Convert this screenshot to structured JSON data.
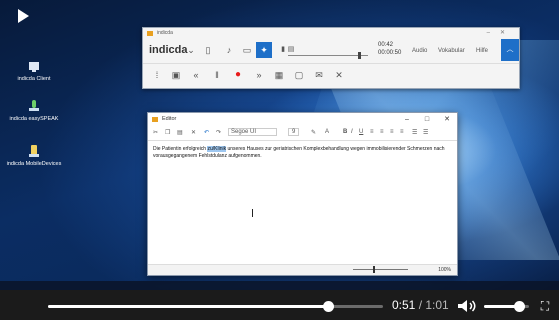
{
  "desktop": {
    "icons": [
      {
        "label": "indicda Client",
        "icon": "client-app-icon"
      },
      {
        "label": "indicda easySPEAK",
        "icon": "microphone-app-icon"
      },
      {
        "label": "indicda MobileDevices",
        "icon": "mobile-app-icon"
      }
    ]
  },
  "toolbar_window": {
    "title": "indicda",
    "logo": "indicda",
    "time_current": "00:42",
    "time_total": "00:00:50",
    "audio_label": "Audio",
    "vocabulary_label": "Vokabular",
    "help_label": "Hilfe",
    "accent_color": "#1e6fc8",
    "record_color": "#e81b1b"
  },
  "editor_window": {
    "title": "Editor",
    "font_name": "Segoe UI",
    "font_size": "9",
    "text_before": "Die Patientin erfolgreich ",
    "text_selected": "zu/Klinik",
    "text_after": " unseres Hauses zur geriatrischen Komplexbehandlung wegen immobilisierender Schmerzen nach vorausgegangenem Fehlstdulanz aufgenommen.",
    "zoom": "100%"
  },
  "video": {
    "current_time": "0:51",
    "separator": " / ",
    "total_time": "1:01",
    "progress_fraction": 0.836,
    "volume_fraction": 0.78
  }
}
